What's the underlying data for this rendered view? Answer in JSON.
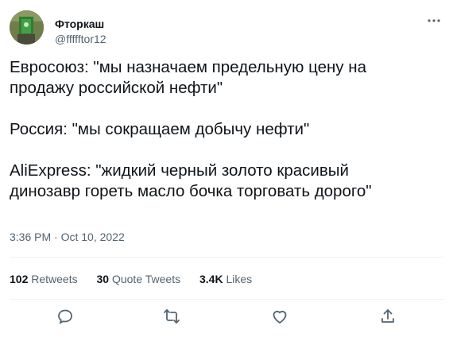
{
  "author": {
    "display_name": "Фторкаш",
    "handle": "@ffffftor12"
  },
  "tweet": {
    "text": "Евросоюз: \"мы назначаем предельную цену на\nпродажу российской нефти\"\n\nРоссия: \"мы сокращаем добычу нефти\"\n\nAliExpress: \"жидкий черный золото красивый\nдинозавр гореть масло бочка торговать дорого\"",
    "timestamp": "3:36 PM · Oct 10, 2022"
  },
  "stats": {
    "retweets_count": "102",
    "retweets_label": "Retweets",
    "quotes_count": "30",
    "quotes_label": "Quote Tweets",
    "likes_count": "3.4K",
    "likes_label": "Likes"
  },
  "icons": {
    "more": "more-horizontal-icon",
    "reply": "reply-icon",
    "retweet": "retweet-icon",
    "like": "heart-icon",
    "share": "share-icon"
  },
  "colors": {
    "text": "#0f1419",
    "secondary": "#536471",
    "divider": "#eff3f4"
  }
}
